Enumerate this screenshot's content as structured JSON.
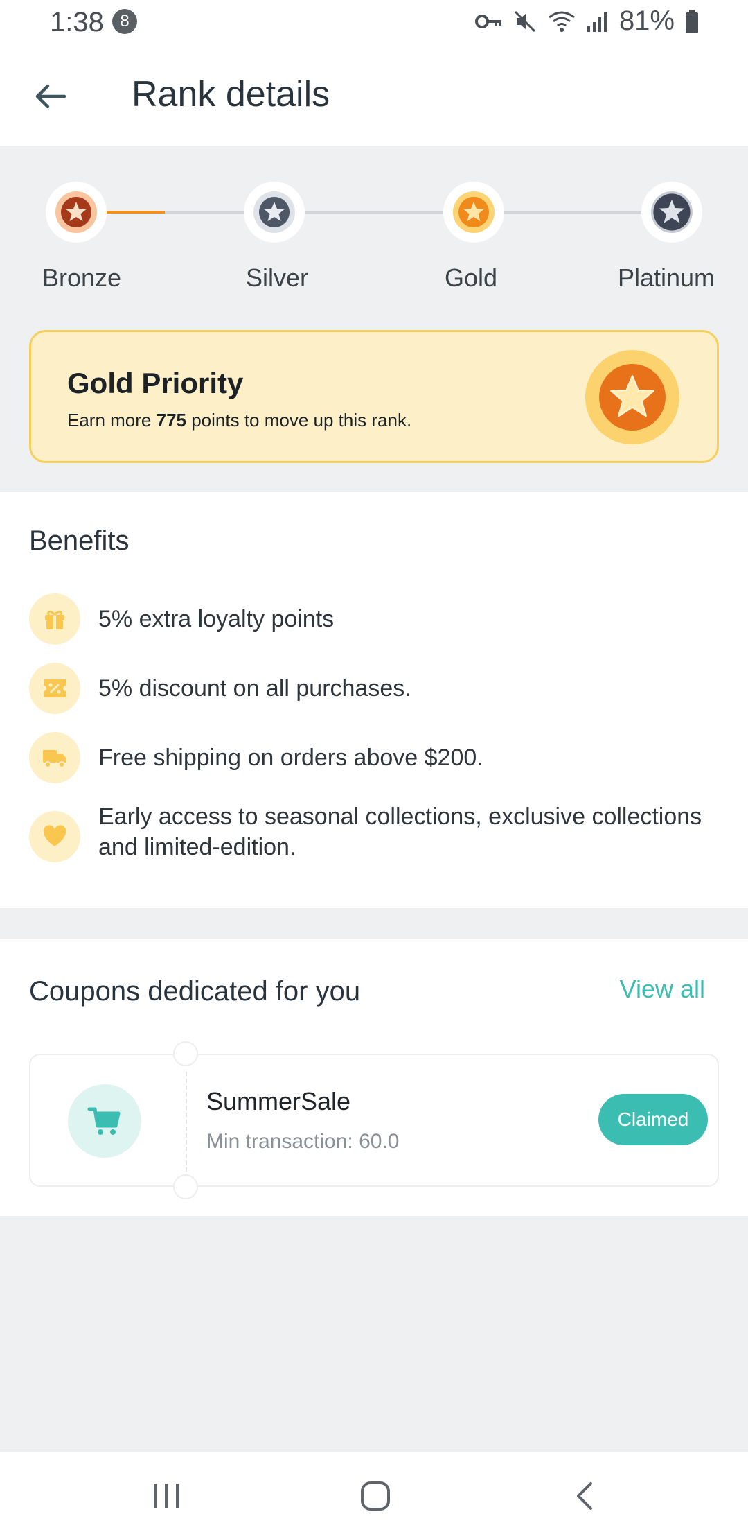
{
  "status": {
    "time": "1:38",
    "notification_count": "8",
    "battery": "81%"
  },
  "header": {
    "title": "Rank details"
  },
  "ranks": [
    {
      "label": "Bronze",
      "color": "#a53a1b"
    },
    {
      "label": "Silver",
      "color": "#4d5766"
    },
    {
      "label": "Gold",
      "color": "#ef8a1b"
    },
    {
      "label": "Platinum",
      "color": "#3e4656"
    }
  ],
  "gold_card": {
    "title": "Gold Priority",
    "sub_prefix": "Earn more ",
    "points": "775",
    "sub_suffix": " points to move up this rank."
  },
  "benefits": {
    "title": "Benefits",
    "items": [
      {
        "icon": "gift-icon",
        "text": "5% extra loyalty points"
      },
      {
        "icon": "ticket-icon",
        "text": "5% discount on all purchases."
      },
      {
        "icon": "truck-icon",
        "text": "Free shipping on orders above $200."
      },
      {
        "icon": "heart-icon",
        "text": "Early access to seasonal collections, exclusive collections and limited-edition."
      }
    ]
  },
  "coupons": {
    "title": "Coupons dedicated for you",
    "view_all": "View all",
    "items": [
      {
        "name": "SummerSale",
        "min": "Min transaction: 60.0",
        "status": "Claimed",
        "icon": "cart-icon"
      }
    ]
  },
  "colors": {
    "accent": "#3cbdb2",
    "progress": "#f0901e",
    "gold_card_bg": "#fdf0c8",
    "benefit_icon": "#f9c74f"
  }
}
